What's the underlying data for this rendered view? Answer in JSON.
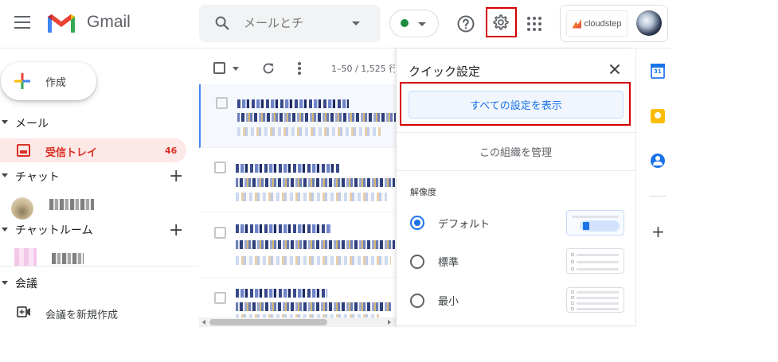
{
  "header": {
    "app_name": "Gmail",
    "search_placeholder": "メールとチ",
    "status_color": "#1e8e3e",
    "account_logo_text": "cloudstep"
  },
  "nav": {
    "compose_label": "作成",
    "mail_section": "メール",
    "inbox_label": "受信トレイ",
    "inbox_count": "46",
    "chat_section": "チャット",
    "chat_room_section": "チャットルーム",
    "meet_section": "会議",
    "meet_new_label": "会議を新規作成"
  },
  "mail_toolbar": {
    "pager": "1–50 / 1,525 行"
  },
  "quick_settings": {
    "title": "クイック設定",
    "see_all_label": "すべての設定を表示",
    "manage_org_label": "この組織を管理",
    "density_label": "解像度",
    "density_options": [
      {
        "label": "デフォルト",
        "selected": true
      },
      {
        "label": "標準",
        "selected": false
      },
      {
        "label": "最小",
        "selected": false
      }
    ]
  },
  "side_panel": {
    "calendar_day": "31"
  },
  "colors": {
    "accent": "#1a73e8",
    "inbox_red": "#d93025",
    "highlight_red": "#d50000"
  }
}
